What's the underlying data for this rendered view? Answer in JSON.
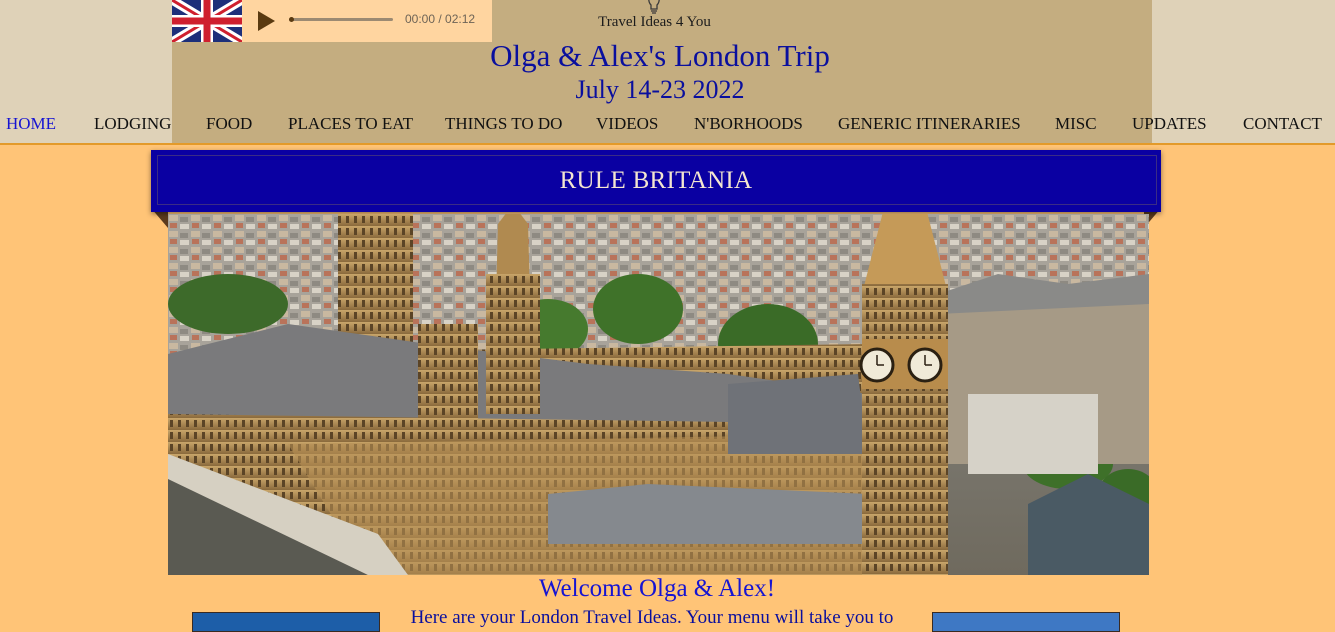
{
  "header": {
    "tagline": "Travel Ideas 4 You",
    "title": "Olga & Alex's London Trip",
    "date": "July 14-23 2022"
  },
  "audio_player": {
    "time_display": "00:00 / 02:12",
    "progress_fraction": 0.0
  },
  "nav": {
    "items": [
      "HOME",
      "LODGING",
      "FOOD",
      "PLACES TO EAT",
      "THINGS TO DO",
      "VIDEOS",
      "N'BORHOODS",
      "GENERIC ITINERARIES",
      "MISC",
      "UPDATES",
      "CONTACT"
    ],
    "active": "HOME"
  },
  "banner": {
    "text": "RULE BRITANIA"
  },
  "main": {
    "welcome": "Welcome Olga & Alex!",
    "intro": "Here are your London Travel Ideas. Your menu will take you to"
  },
  "colors": {
    "page_background": "#ffc477",
    "header_background": "#c4ad80",
    "banner_background": "#0a00a2",
    "title_color": "#0a0f9e",
    "nav_active": "#1614d2"
  },
  "icons": {
    "flag": "union-jack-flag-icon",
    "play": "play-icon",
    "lightbulb": "lightbulb-icon"
  }
}
